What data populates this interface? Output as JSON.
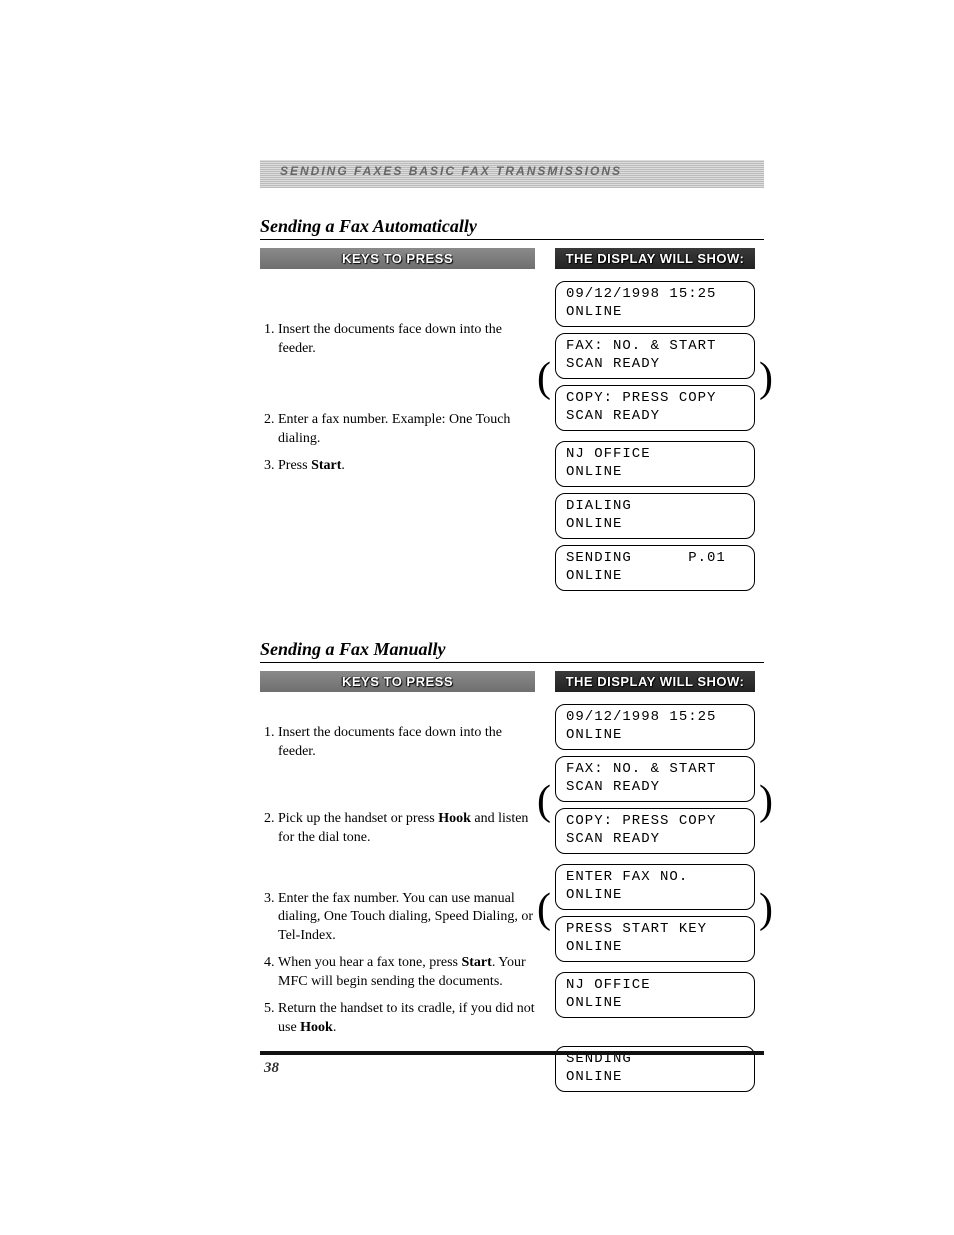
{
  "running_head": "SENDING FAXES   BASIC FAX TRANSMISSIONS",
  "page_number": "38",
  "headers": {
    "keys": "KEYS TO PRESS",
    "display": "THE DISPLAY WILL SHOW:"
  },
  "auto": {
    "title": "Sending a Fax Automatically",
    "steps": [
      "Insert the documents face down into the feeder.",
      "Enter a fax number.\nExample: One Touch dialing.",
      "Press Start."
    ],
    "lcd": {
      "idle": "09/12/1998 15:25\nONLINE",
      "fax_ready": "FAX: NO. & START\nSCAN READY",
      "copy_ready": "COPY: PRESS COPY\nSCAN READY",
      "dest": "NJ OFFICE\nONLINE",
      "dialing": "DIALING\nONLINE",
      "sending": "SENDING      P.01\nONLINE"
    }
  },
  "manual": {
    "title": "Sending a Fax Manually",
    "steps": [
      "Insert the documents face down into the feeder.",
      "Pick up the handset or press Hook and listen for the dial tone.",
      "Enter the fax number.\nYou can use manual dialing, One Touch dialing, Speed Dialing, or Tel-Index.",
      "When you hear a fax tone, press Start. Your MFC will begin sending the documents.",
      "Return the handset to its cradle, if you did not use Hook."
    ],
    "lcd": {
      "idle": "09/12/1998 15:25\nONLINE",
      "fax_ready": "FAX: NO. & START\nSCAN READY",
      "copy_ready": "COPY: PRESS COPY\nSCAN READY",
      "enter_no": "ENTER FAX NO.\nONLINE",
      "press_start": "PRESS START KEY\nONLINE",
      "dest": "NJ OFFICE\nONLINE",
      "sending": "SENDING\nONLINE"
    }
  }
}
